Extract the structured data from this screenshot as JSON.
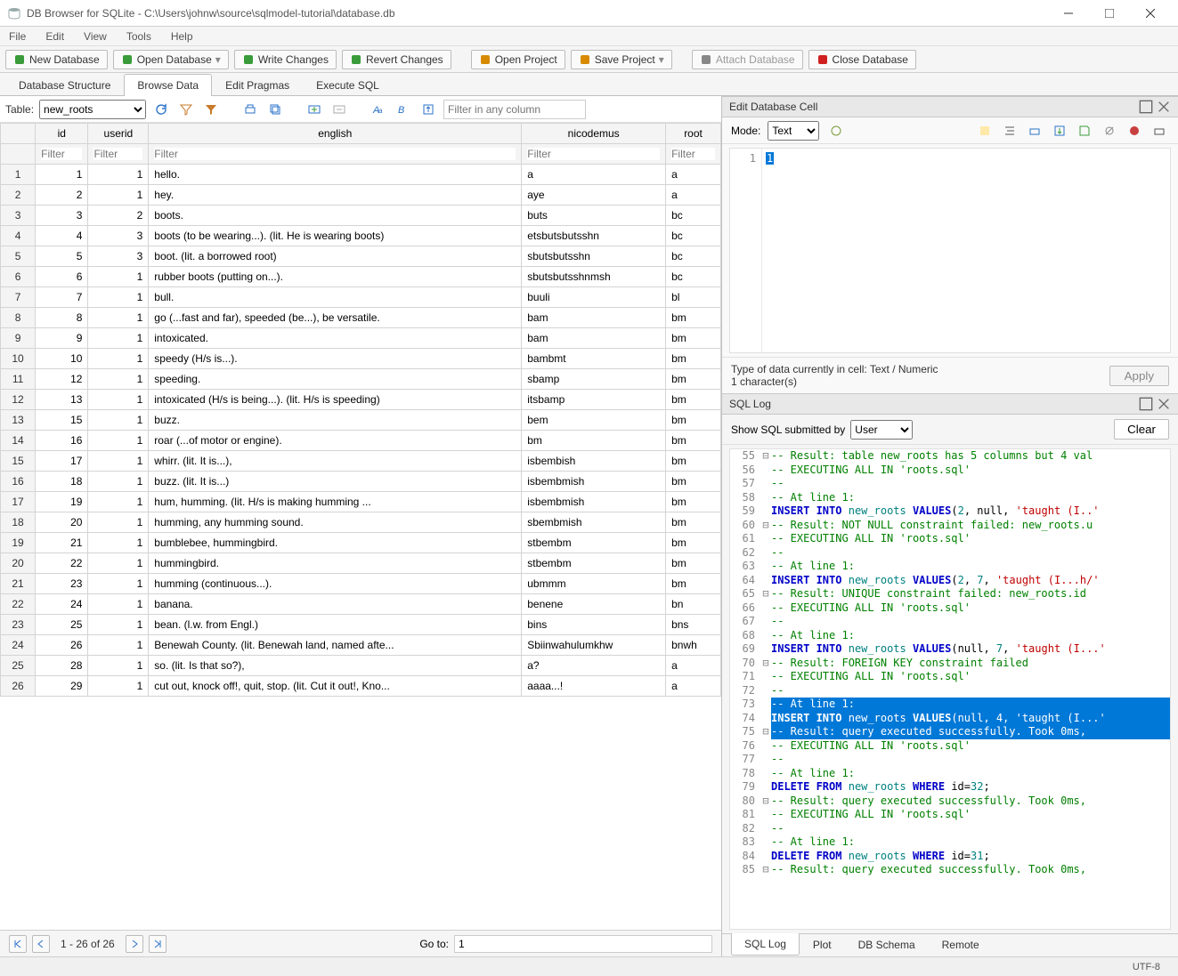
{
  "window": {
    "title": "DB Browser for SQLite - C:\\Users\\johnw\\source\\sqlmodel-tutorial\\database.db"
  },
  "menus": [
    "File",
    "Edit",
    "View",
    "Tools",
    "Help"
  ],
  "toolbar": [
    {
      "label": "New Database",
      "color": "#3a9b3a"
    },
    {
      "label": "Open Database",
      "color": "#3a9b3a",
      "split": true
    },
    {
      "label": "Write Changes",
      "color": "#3a9b3a"
    },
    {
      "label": "Revert Changes",
      "color": "#3a9b3a"
    },
    {
      "label": "Open Project",
      "color": "#d78a00"
    },
    {
      "label": "Save Project",
      "color": "#d78a00",
      "split": true
    },
    {
      "label": "Attach Database",
      "color": "#888",
      "disabled": true
    },
    {
      "label": "Close Database",
      "color": "#d02020"
    }
  ],
  "tabs": {
    "items": [
      "Database Structure",
      "Browse Data",
      "Edit Pragmas",
      "Execute SQL"
    ],
    "active": 1
  },
  "browse": {
    "table_label": "Table:",
    "table_select": "new_roots",
    "filter_placeholder": "Filter in any column",
    "col_filter_placeholder": "Filter"
  },
  "columns": [
    "id",
    "userid",
    "english",
    "nicodemus",
    "root"
  ],
  "rows": [
    {
      "n": 1,
      "id": 1,
      "userid": 1,
      "english": "hello.",
      "nic": "a",
      "root": "a"
    },
    {
      "n": 2,
      "id": 2,
      "userid": 1,
      "english": "hey.",
      "nic": "aye",
      "root": "a"
    },
    {
      "n": 3,
      "id": 3,
      "userid": 2,
      "english": "boots.",
      "nic": "buts",
      "root": "bc"
    },
    {
      "n": 4,
      "id": 4,
      "userid": 3,
      "english": "boots (to be wearing...). (lit. He is wearing boots)",
      "nic": "etsbutsbutsshn",
      "root": "bc"
    },
    {
      "n": 5,
      "id": 5,
      "userid": 3,
      "english": "boot. (lit. a borrowed root)",
      "nic": "sbutsbutsshn",
      "root": "bc"
    },
    {
      "n": 6,
      "id": 6,
      "userid": 1,
      "english": "rubber boots (putting on...).",
      "nic": "sbutsbutsshnmsh",
      "root": "bc"
    },
    {
      "n": 7,
      "id": 7,
      "userid": 1,
      "english": "bull.",
      "nic": "buuli",
      "root": "bl"
    },
    {
      "n": 8,
      "id": 8,
      "userid": 1,
      "english": "go (...fast and far), speeded (be...), be versatile.",
      "nic": "bam",
      "root": "bm"
    },
    {
      "n": 9,
      "id": 9,
      "userid": 1,
      "english": "intoxicated.",
      "nic": "bam",
      "root": "bm"
    },
    {
      "n": 10,
      "id": 10,
      "userid": 1,
      "english": "speedy (H/s is...).",
      "nic": "bambmt",
      "root": "bm"
    },
    {
      "n": 11,
      "id": 12,
      "userid": 1,
      "english": "speeding.",
      "nic": "sbamp",
      "root": "bm"
    },
    {
      "n": 12,
      "id": 13,
      "userid": 1,
      "english": "intoxicated (H/s is being...). (lit. H/s is speeding)",
      "nic": "itsbamp",
      "root": "bm"
    },
    {
      "n": 13,
      "id": 15,
      "userid": 1,
      "english": "buzz.",
      "nic": "bem",
      "root": "bm"
    },
    {
      "n": 14,
      "id": 16,
      "userid": 1,
      "english": "roar (...of motor or engine).",
      "nic": "bm",
      "root": "bm"
    },
    {
      "n": 15,
      "id": 17,
      "userid": 1,
      "english": "whirr. (lit. It is...),",
      "nic": "isbembish",
      "root": "bm"
    },
    {
      "n": 16,
      "id": 18,
      "userid": 1,
      "english": "buzz. (lit. It is...)",
      "nic": "isbembmish",
      "root": "bm"
    },
    {
      "n": 17,
      "id": 19,
      "userid": 1,
      "english": "hum, humming. (lit. H/s is making humming ...",
      "nic": "isbembmish",
      "root": "bm"
    },
    {
      "n": 18,
      "id": 20,
      "userid": 1,
      "english": "humming, any humming sound.",
      "nic": "sbembmish",
      "root": "bm"
    },
    {
      "n": 19,
      "id": 21,
      "userid": 1,
      "english": "bumblebee, hummingbird.",
      "nic": "stbembm",
      "root": "bm"
    },
    {
      "n": 20,
      "id": 22,
      "userid": 1,
      "english": "hummingbird.",
      "nic": "stbembm",
      "root": "bm"
    },
    {
      "n": 21,
      "id": 23,
      "userid": 1,
      "english": "humming (continuous...).",
      "nic": "ubmmm",
      "root": "bm"
    },
    {
      "n": 22,
      "id": 24,
      "userid": 1,
      "english": "banana.",
      "nic": "benene",
      "root": "bn"
    },
    {
      "n": 23,
      "id": 25,
      "userid": 1,
      "english": "bean. (l.w. from Engl.)",
      "nic": "bins",
      "root": "bns"
    },
    {
      "n": 24,
      "id": 26,
      "userid": 1,
      "english": "Benewah County. (lit. Benewah land, named afte...",
      "nic": "Sbiinwahulumkhw",
      "root": "bnwh"
    },
    {
      "n": 25,
      "id": 28,
      "userid": 1,
      "english": "so. (lit. Is that so?),",
      "nic": "a?",
      "root": "a"
    },
    {
      "n": 26,
      "id": 29,
      "userid": 1,
      "english": "cut out, knock off!, quit, stop. (lit. Cut it out!, Kno...",
      "nic": "aaaa...!",
      "root": "a"
    }
  ],
  "pager": {
    "status": "1 - 26 of 26",
    "goto_label": "Go to:",
    "goto_value": "1"
  },
  "cell_panel": {
    "title": "Edit Database Cell",
    "mode_label": "Mode:",
    "mode_value": "Text",
    "line_num": "1",
    "content": "1",
    "type_text": "Type of data currently in cell: Text / Numeric",
    "chars_text": "1 character(s)",
    "apply": "Apply"
  },
  "sql_panel": {
    "title": "SQL Log",
    "show_label": "Show SQL submitted by",
    "show_value": "User",
    "clear": "Clear"
  },
  "sql_lines": [
    {
      "n": 55,
      "fold": "⊟",
      "cls": "cm",
      "txt": "-- Result: table new_roots has 5 columns but 4 val"
    },
    {
      "n": 56,
      "fold": "",
      "cls": "cm",
      "txt": "-- EXECUTING ALL IN 'roots.sql'"
    },
    {
      "n": 57,
      "fold": "",
      "cls": "cm",
      "txt": "--"
    },
    {
      "n": 58,
      "fold": "",
      "cls": "cm",
      "txt": "-- At line 1:"
    },
    {
      "n": 59,
      "fold": "",
      "cls": "",
      "html": "<span class='kw'>INSERT INTO</span> <span class='fn'>new_roots</span> <span class='kw'>VALUES</span>(<span class='num2'>2</span>, null, <span class='str'>'taught (I..'</span>"
    },
    {
      "n": 60,
      "fold": "⊟",
      "cls": "cm",
      "txt": "-- Result: NOT NULL constraint failed: new_roots.u"
    },
    {
      "n": 61,
      "fold": "",
      "cls": "cm",
      "txt": "-- EXECUTING ALL IN 'roots.sql'"
    },
    {
      "n": 62,
      "fold": "",
      "cls": "cm",
      "txt": "--"
    },
    {
      "n": 63,
      "fold": "",
      "cls": "cm",
      "txt": "-- At line 1:"
    },
    {
      "n": 64,
      "fold": "",
      "cls": "",
      "html": "<span class='kw'>INSERT INTO</span> <span class='fn'>new_roots</span> <span class='kw'>VALUES</span>(<span class='num2'>2</span>, <span class='num2'>7</span>, <span class='str'>'taught (I...h/'</span>"
    },
    {
      "n": 65,
      "fold": "⊟",
      "cls": "cm",
      "txt": "-- Result: UNIQUE constraint failed: new_roots.id"
    },
    {
      "n": 66,
      "fold": "",
      "cls": "cm",
      "txt": "-- EXECUTING ALL IN 'roots.sql'"
    },
    {
      "n": 67,
      "fold": "",
      "cls": "cm",
      "txt": "--"
    },
    {
      "n": 68,
      "fold": "",
      "cls": "cm",
      "txt": "-- At line 1:"
    },
    {
      "n": 69,
      "fold": "",
      "cls": "",
      "html": "<span class='kw'>INSERT INTO</span> <span class='fn'>new_roots</span> <span class='kw'>VALUES</span>(null, <span class='num2'>7</span>, <span class='str'>'taught (I...'</span>"
    },
    {
      "n": 70,
      "fold": "⊟",
      "cls": "cm",
      "txt": "-- Result: FOREIGN KEY constraint failed"
    },
    {
      "n": 71,
      "fold": "",
      "cls": "cm",
      "txt": "-- EXECUTING ALL IN 'roots.sql'"
    },
    {
      "n": 72,
      "fold": "",
      "cls": "cm",
      "txt": "--"
    },
    {
      "n": 73,
      "fold": "",
      "cls": "cm",
      "txt": "-- At line 1:",
      "sel": true
    },
    {
      "n": 74,
      "fold": "",
      "cls": "",
      "html": "<span class='kw'>INSERT INTO</span> <span class='fn'>new_roots</span> <span class='kw'>VALUES</span>(null, <span class='num2'>4</span>, <span class='str'>'taught (I...'</span>",
      "sel": true
    },
    {
      "n": 75,
      "fold": "⊟",
      "cls": "cm",
      "txt": "-- Result: query executed successfully. Took 0ms,",
      "sel": true
    },
    {
      "n": 76,
      "fold": "",
      "cls": "cm",
      "txt": "-- EXECUTING ALL IN 'roots.sql'"
    },
    {
      "n": 77,
      "fold": "",
      "cls": "cm",
      "txt": "--"
    },
    {
      "n": 78,
      "fold": "",
      "cls": "cm",
      "txt": "-- At line 1:"
    },
    {
      "n": 79,
      "fold": "",
      "cls": "",
      "html": "<span class='kw'>DELETE FROM</span> <span class='fn'>new_roots</span> <span class='kw'>WHERE</span> id=<span class='num2'>32</span>;"
    },
    {
      "n": 80,
      "fold": "⊟",
      "cls": "cm",
      "txt": "-- Result: query executed successfully. Took 0ms,"
    },
    {
      "n": 81,
      "fold": "",
      "cls": "cm",
      "txt": "-- EXECUTING ALL IN 'roots.sql'"
    },
    {
      "n": 82,
      "fold": "",
      "cls": "cm",
      "txt": "--"
    },
    {
      "n": 83,
      "fold": "",
      "cls": "cm",
      "txt": "-- At line 1:"
    },
    {
      "n": 84,
      "fold": "",
      "cls": "",
      "html": "<span class='kw'>DELETE FROM</span> <span class='fn'>new_roots</span> <span class='kw'>WHERE</span> id=<span class='num2'>31</span>;"
    },
    {
      "n": 85,
      "fold": "⊟",
      "cls": "cm",
      "txt": "-- Result: query executed successfully. Took 0ms,"
    }
  ],
  "bottom_tabs": {
    "items": [
      "SQL Log",
      "Plot",
      "DB Schema",
      "Remote"
    ],
    "active": 0
  },
  "statusbar": {
    "encoding": "UTF-8"
  }
}
